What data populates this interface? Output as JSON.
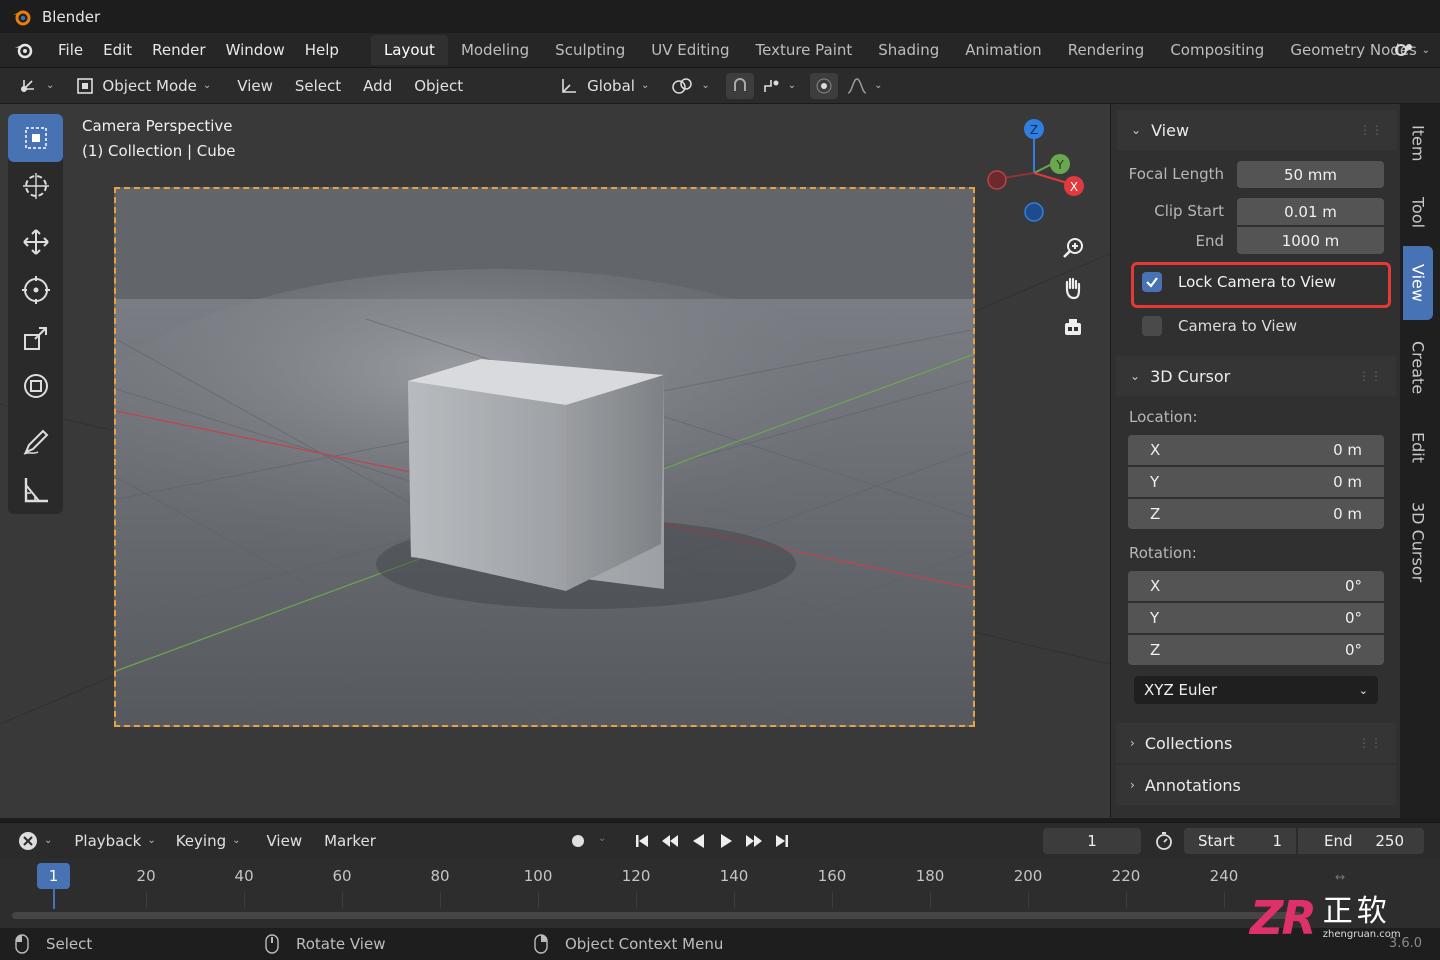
{
  "app": {
    "title": "Blender"
  },
  "menu": [
    "File",
    "Edit",
    "Render",
    "Window",
    "Help"
  ],
  "workspaces": [
    "Layout",
    "Modeling",
    "Sculpting",
    "UV Editing",
    "Texture Paint",
    "Shading",
    "Animation",
    "Rendering",
    "Compositing",
    "Geometry Nodes"
  ],
  "toolbar": {
    "mode": "Object Mode",
    "view": "View",
    "select": "Select",
    "add": "Add",
    "object": "Object",
    "orientation": "Global"
  },
  "viewport": {
    "line1": "Camera Perspective",
    "line2": "(1) Collection | Cube"
  },
  "gizmo": {
    "z": "Z",
    "y": "Y",
    "x": "X"
  },
  "sidebar": {
    "view_panel": "View",
    "focal_label": "Focal Length",
    "focal_value": "50 mm",
    "clip_start_label": "Clip Start",
    "clip_start_value": "0.01 m",
    "end_label": "End",
    "end_value": "1000 m",
    "lock_camera": "Lock Camera to View",
    "camera_to_view": "Camera to View",
    "cursor_panel": "3D Cursor",
    "location_label": "Location:",
    "loc": [
      {
        "axis": "X",
        "value": "0 m"
      },
      {
        "axis": "Y",
        "value": "0 m"
      },
      {
        "axis": "Z",
        "value": "0 m"
      }
    ],
    "rotation_label": "Rotation:",
    "rot": [
      {
        "axis": "X",
        "value": "0°"
      },
      {
        "axis": "Y",
        "value": "0°"
      },
      {
        "axis": "Z",
        "value": "0°"
      }
    ],
    "rotation_mode": "XYZ Euler",
    "collections_panel": "Collections",
    "annotations_panel": "Annotations"
  },
  "tabs": [
    "Item",
    "Tool",
    "View",
    "Create",
    "Edit",
    "3D Cursor"
  ],
  "timeline": {
    "playback": "Playback",
    "keying": "Keying",
    "view": "View",
    "marker": "Marker",
    "current": "1",
    "start_label": "Start",
    "start": "1",
    "end_label": "End",
    "end": "250",
    "marker_frame": "1",
    "ticks": [
      "20",
      "40",
      "60",
      "80",
      "100",
      "120",
      "140",
      "160",
      "180",
      "200",
      "220",
      "240"
    ]
  },
  "status": {
    "select": "Select",
    "rotate": "Rotate View",
    "context": "Object Context Menu",
    "version": "3.6.0"
  },
  "watermark": {
    "brand": "ZR",
    "cn": "正软",
    "url": "zhengruan.com"
  },
  "colors": {
    "accent": "#4772b3",
    "highlight": "#e53935",
    "camera_frame": "#e8a240",
    "x_axis": "#e0393e",
    "y_axis": "#6aa84f",
    "z_axis": "#2f7fe0"
  }
}
